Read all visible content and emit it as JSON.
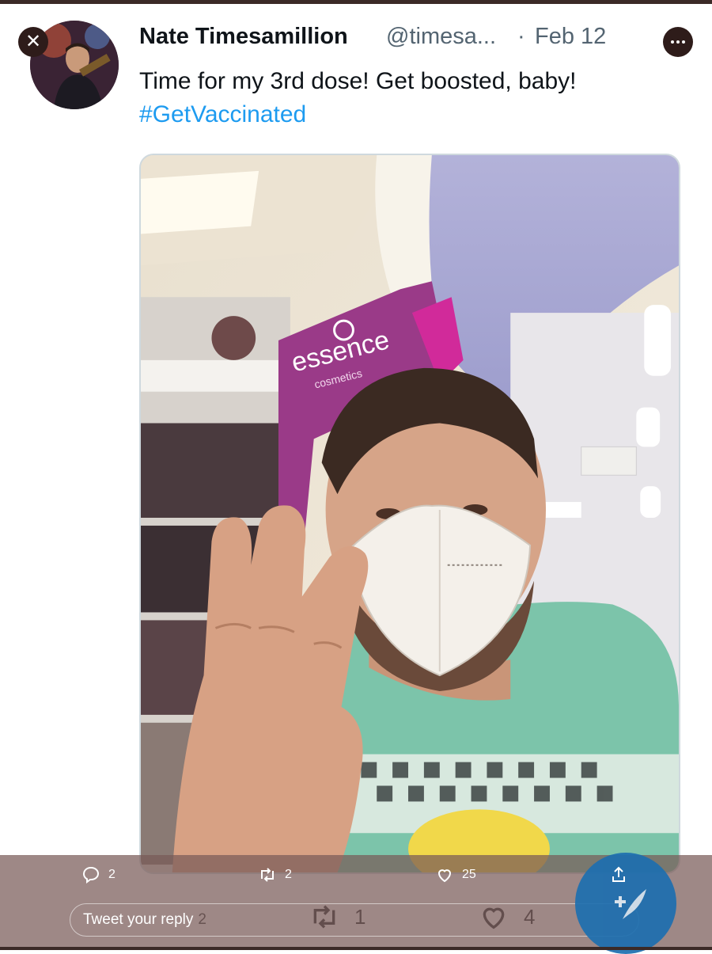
{
  "tweet": {
    "author_name": "Nate Timesamillion",
    "handle": "@timesa...",
    "separator": "·",
    "date": "Feb 12",
    "text": "Time for my 3rd dose! Get boosted, baby!",
    "hashtag": "#GetVaccinated"
  },
  "media": {
    "sign_brand": "essence",
    "sign_sub": "cosmetics"
  },
  "actions": {
    "reply_count": "2",
    "retweet_count": "2",
    "like_count": "25"
  },
  "background_tweet": {
    "reply_count": "2",
    "retweet_count": "1",
    "like_count": "4"
  },
  "reply_box": {
    "placeholder": "Tweet your reply"
  },
  "icons": {
    "close": "close-icon",
    "more": "more-icon",
    "reply": "reply-icon",
    "retweet": "retweet-icon",
    "like": "heart-icon",
    "share": "share-icon",
    "compose": "compose-feather-icon"
  },
  "colors": {
    "hashtag": "#1d9bf0",
    "secondary_text": "#536471",
    "compose": "#1d6fb0"
  }
}
